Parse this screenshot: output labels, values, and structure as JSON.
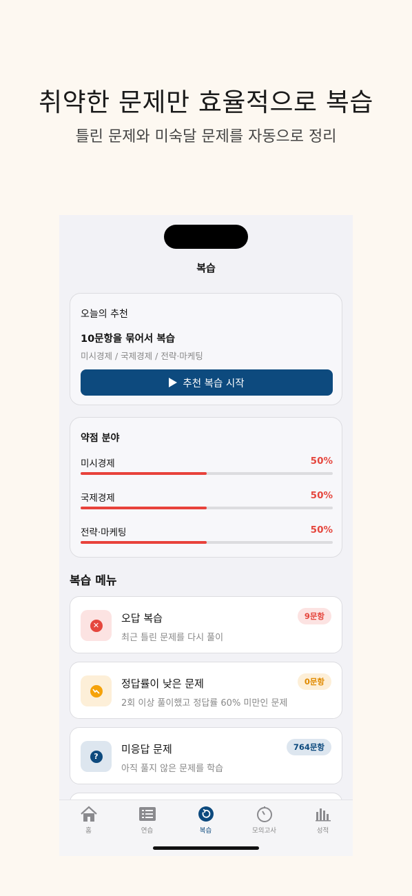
{
  "hero": {
    "title": "취약한 문제만 효율적으로 복습",
    "subtitle": "틀린 문제와 미숙달 문제를 자동으로 정리"
  },
  "screen": {
    "title": "복습"
  },
  "recommendation": {
    "label": "오늘의 추천",
    "headline": "10문항을 묶어서 복습",
    "subjects": "미시경제 / 국제경제 / 전략·마케팅",
    "button_label": "추천 복습 시작",
    "button_icon": "play-icon"
  },
  "weak_areas": {
    "label": "약점 분야",
    "items": [
      {
        "name": "미시경제",
        "percent_label": "50%",
        "fraction": 0.5
      },
      {
        "name": "국제경제",
        "percent_label": "50%",
        "fraction": 0.5
      },
      {
        "name": "전략·마케팅",
        "percent_label": "50%",
        "fraction": 0.5
      }
    ]
  },
  "review_menu": {
    "title": "복습 메뉴",
    "items": [
      {
        "title": "오답 복습",
        "desc": "최근 틀린 문제를 다시 풀이",
        "badge": "9문항",
        "icon": "x-circle-icon"
      },
      {
        "title": "정답률이 낮은 문제",
        "desc": "2회 이상 풀이했고 정답률 60% 미만인 문제",
        "badge": "0문항",
        "icon": "chart-down-icon"
      },
      {
        "title": "미응답 문제",
        "desc": "아직 풀지 않은 문제를 학습",
        "badge": "764문항",
        "icon": "question-circle-icon"
      }
    ]
  },
  "tabs": [
    {
      "label": "홈",
      "icon": "home-icon"
    },
    {
      "label": "연습",
      "icon": "list-icon"
    },
    {
      "label": "복습",
      "icon": "review-icon",
      "active": true
    },
    {
      "label": "모의고사",
      "icon": "timer-icon"
    },
    {
      "label": "성적",
      "icon": "bar-chart-icon"
    }
  ],
  "colors": {
    "primary": "#0D4A7E",
    "danger": "#E5473E",
    "warning": "#F5A20A",
    "background": "#FDF8F1"
  }
}
